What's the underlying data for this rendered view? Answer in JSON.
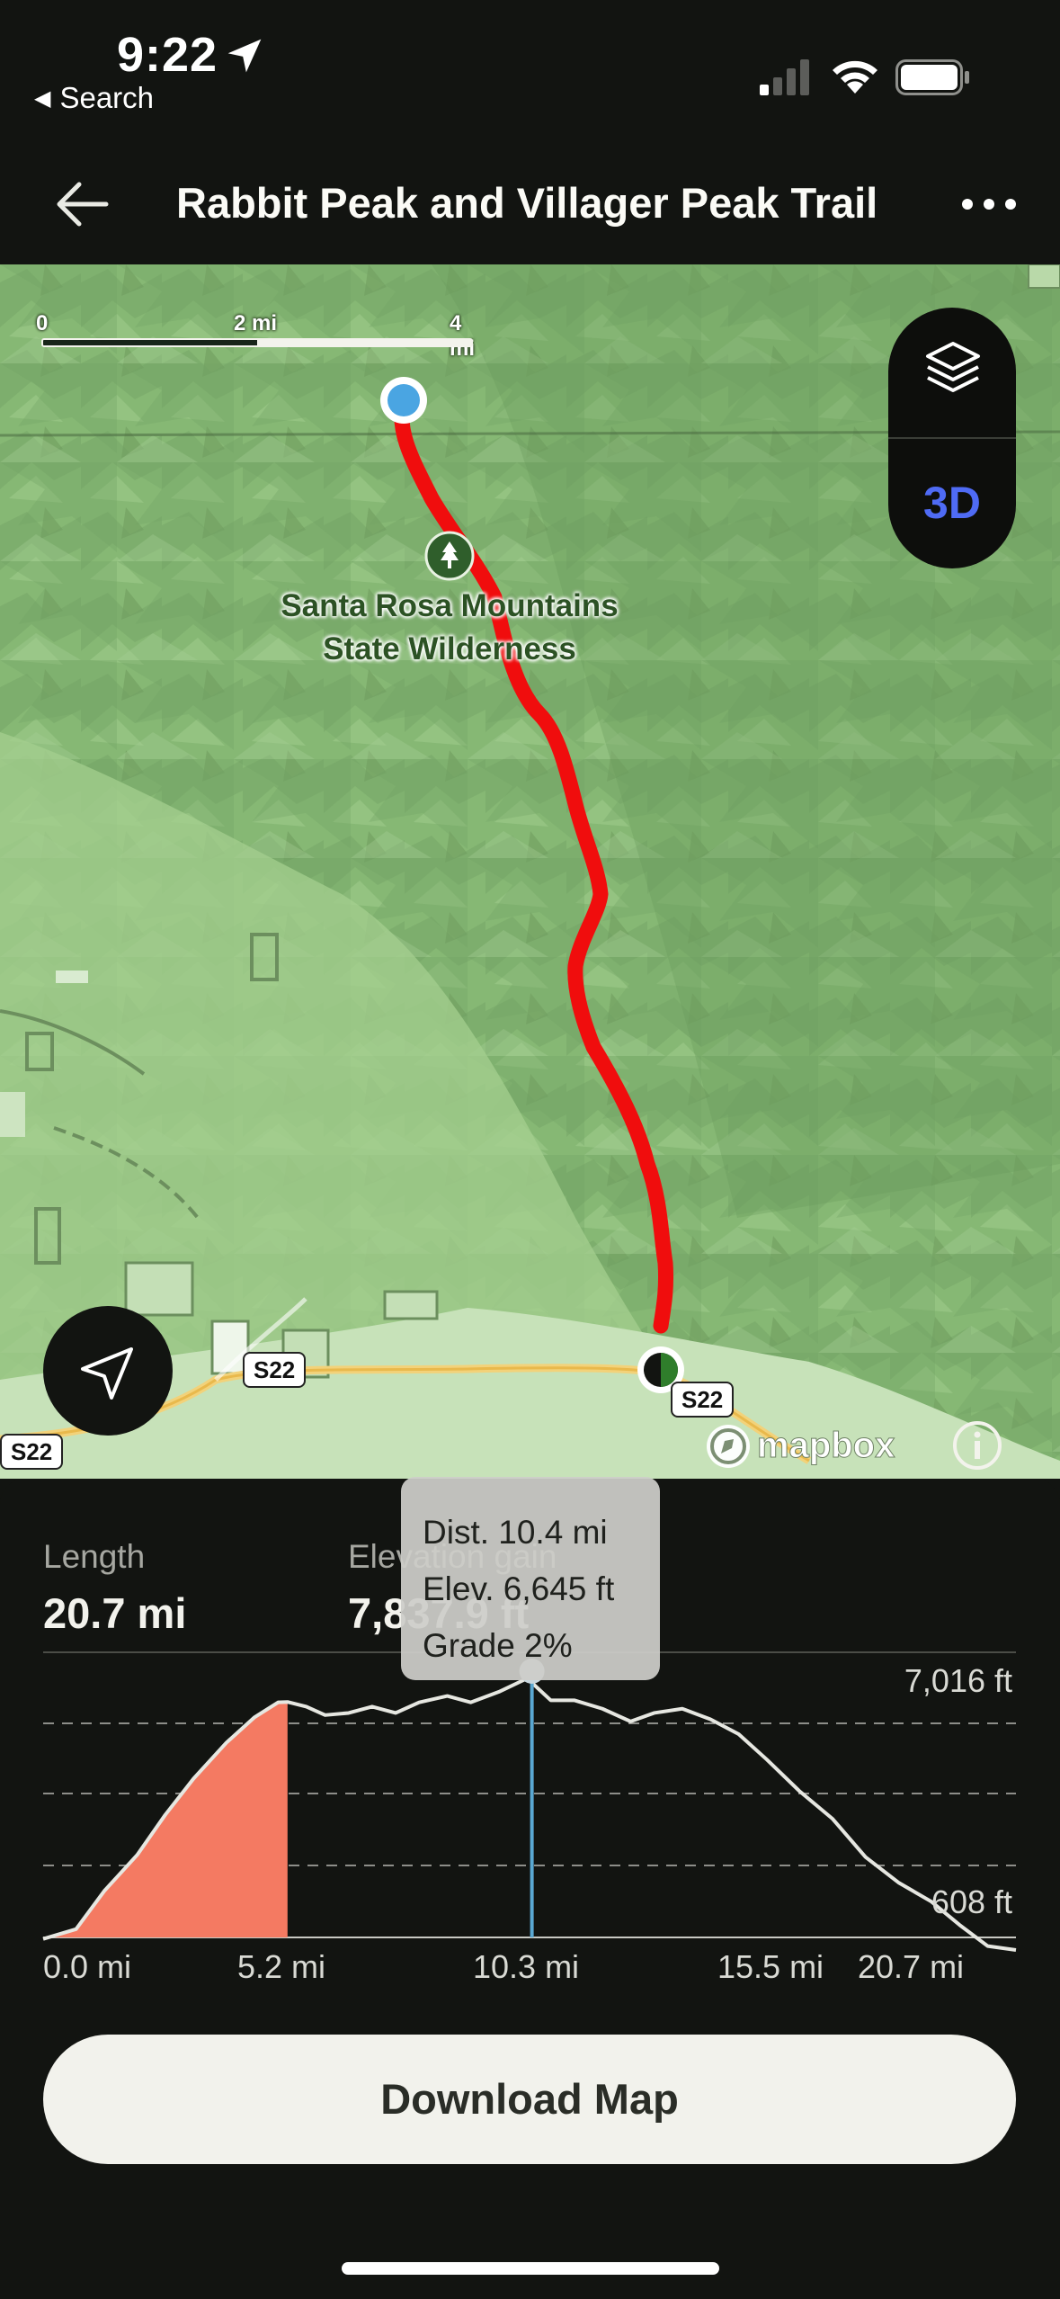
{
  "status_bar": {
    "time": "9:22",
    "back_app": "Search",
    "icons": [
      "location-arrow-icon",
      "cellular-signal-icon",
      "wifi-icon",
      "battery-icon"
    ]
  },
  "header": {
    "title": "Rabbit Peak and Villager Peak Trail",
    "icons": [
      "back-arrow-icon",
      "more-options-icon"
    ]
  },
  "map": {
    "scale": {
      "labels": [
        "0",
        "2 mi",
        "4 mi"
      ]
    },
    "layer_control": {
      "three_d_label": "3D",
      "layers_icon": "layers-icon"
    },
    "place_label_line1": "Santa Rosa Mountains",
    "place_label_line2": "State Wilderness",
    "road_badges": [
      "S22",
      "S22",
      "S22"
    ],
    "attribution": "mapbox",
    "route_color": "#f00d0d",
    "map_color": "#8cbc78"
  },
  "stats": {
    "length_label": "Length",
    "length_value": "20.7 mi",
    "gain_label": "Elevation gain",
    "gain_value": "7,837.9 ft"
  },
  "tooltip": {
    "dist": "Dist. 10.4 mi",
    "elev": "Elev. 6,645 ft",
    "grade": "Grade 2%"
  },
  "chart_data": {
    "type": "area",
    "y_max_label": "7,016 ft",
    "y_min_label": "608 ft",
    "ylim": [
      608,
      7016
    ],
    "xlim": [
      0,
      20.7
    ],
    "x_tick_labels": [
      "0.0 mi",
      "5.2 mi",
      "10.3 mi",
      "15.5 mi",
      "20.7 mi"
    ],
    "highlight_until_mi": 5.2,
    "highlight_color": "#f47a62",
    "cursor_mi": 10.4,
    "cursor_color": "#5aa8d2",
    "grid": "dashed",
    "profile_x": [
      0,
      0.7,
      1.3,
      2.0,
      2.6,
      3.2,
      3.9,
      4.5,
      5.0,
      5.2,
      5.6,
      6.0,
      6.5,
      7.0,
      7.5,
      8.0,
      8.6,
      9.1,
      9.7,
      10.3,
      10.8,
      11.3,
      11.9,
      12.5,
      13.0,
      13.6,
      14.2,
      14.8,
      15.4,
      16.1,
      16.8,
      17.5,
      18.2,
      18.9,
      19.5,
      20.1,
      20.7
    ],
    "profile_y": [
      870,
      1100,
      2000,
      2850,
      3800,
      4650,
      5500,
      6100,
      6450,
      6460,
      6350,
      6150,
      6200,
      6350,
      6200,
      6450,
      6600,
      6450,
      6700,
      7016,
      6500,
      6500,
      6300,
      6000,
      6200,
      6300,
      6050,
      5700,
      5100,
      4350,
      3700,
      2800,
      2200,
      1750,
      1200,
      700,
      608
    ]
  },
  "actions": {
    "download_label": "Download Map"
  }
}
